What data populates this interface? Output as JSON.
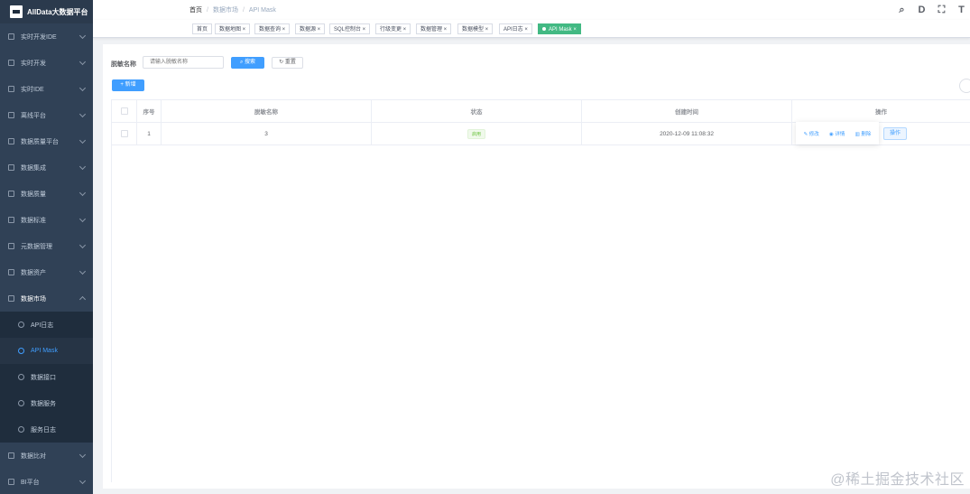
{
  "app": {
    "title": "AllData大数据平台"
  },
  "sidebar": {
    "items": [
      {
        "label": "实时开发IDE"
      },
      {
        "label": "实时开发"
      },
      {
        "label": "实时IDE"
      },
      {
        "label": "离线平台"
      },
      {
        "label": "数据质量平台"
      },
      {
        "label": "数据集成"
      },
      {
        "label": "数据质量"
      },
      {
        "label": "数据标准"
      },
      {
        "label": "元数据管理"
      },
      {
        "label": "数据资产"
      },
      {
        "label": "数据市场"
      }
    ],
    "sub_items": [
      {
        "label": "API日志"
      },
      {
        "label": "API Mask"
      },
      {
        "label": "数据接口"
      },
      {
        "label": "数据服务"
      },
      {
        "label": "服务日志"
      }
    ],
    "bottom_items": [
      {
        "label": "数据比对"
      },
      {
        "label": "BI平台"
      }
    ]
  },
  "header": {
    "breadcrumb": [
      "首页",
      "数据市场",
      "API Mask"
    ]
  },
  "tags": [
    "首页",
    "数据地图",
    "数据查询",
    "数据源",
    "SQL控制台",
    "行级变更",
    "数据管理",
    "数据模型",
    "API日志",
    "API Mask"
  ],
  "search": {
    "label": "脱敏名称",
    "placeholder": "请输入脱敏名称",
    "search_button": "搜索",
    "reset_button": "重置",
    "add_button": "新增"
  },
  "table": {
    "columns": [
      "",
      "序号",
      "脱敏名称",
      "状态",
      "创建时间",
      "操作"
    ],
    "rows": [
      {
        "index": "1",
        "name": "3",
        "status": "启用",
        "created": "2020-12-09 11:08:32"
      }
    ],
    "ops": {
      "edit": "修改",
      "detail": "详情",
      "delete": "删除",
      "more": "操作"
    }
  },
  "watermark": "@稀土掘金技术社区"
}
